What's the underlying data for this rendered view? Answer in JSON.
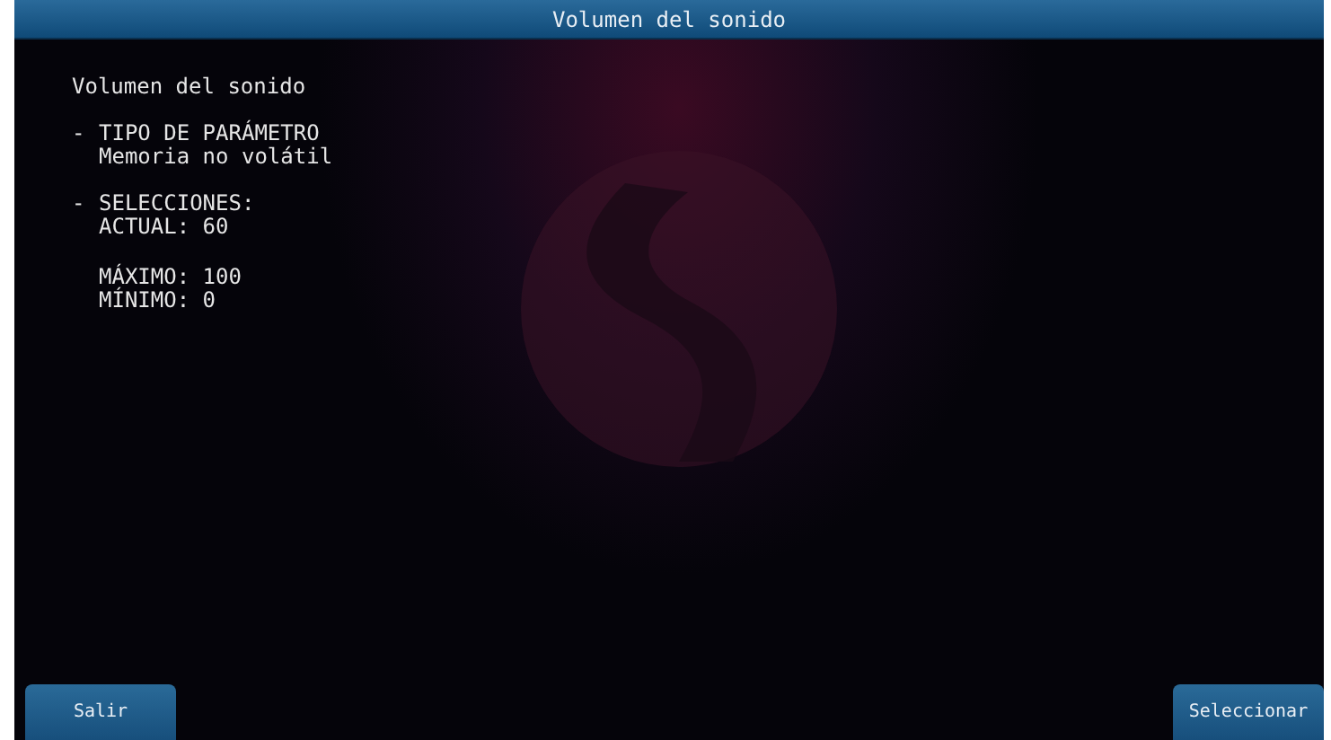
{
  "title_bar": {
    "title": "Volumen del sonido"
  },
  "content": {
    "heading": "Volumen del sonido",
    "sections": [
      {
        "bullet": "-",
        "lines": [
          "TIPO DE PARÁMETRO",
          "Memoria no volátil"
        ]
      },
      {
        "bullet": "-",
        "lines": [
          "SELECCIONES:",
          "ACTUAL: 60"
        ]
      },
      {
        "lines": [
          "MÁXIMO: 100",
          "MÍNIMO: 0"
        ]
      }
    ]
  },
  "buttons": [
    {
      "label": "Salir"
    },
    {
      "label": "Seleccionar"
    }
  ]
}
